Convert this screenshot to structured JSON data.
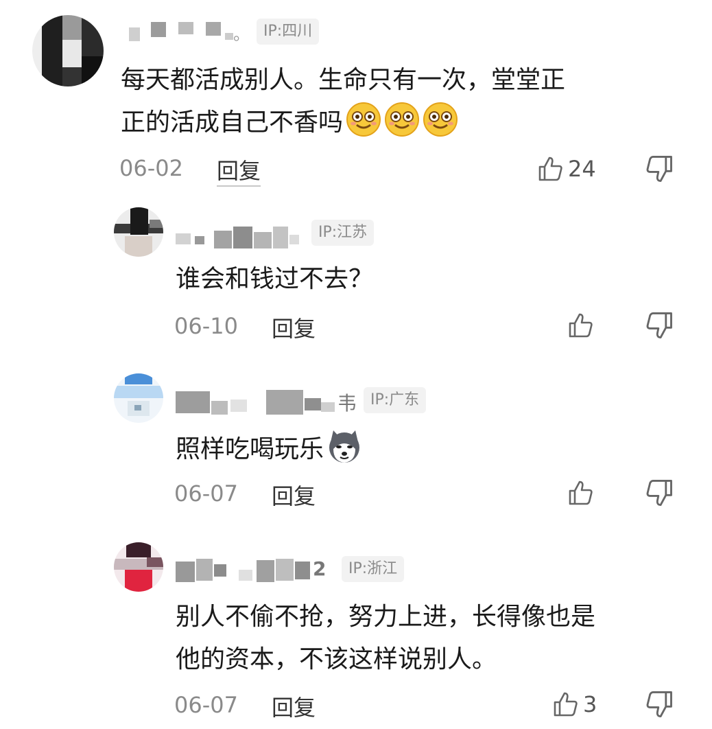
{
  "comments": [
    {
      "ip": "IP:四川",
      "name_suffix": "。",
      "lines": [
        "每天都活成别人。生命只有一次，堂堂正",
        "正的活成自己不香吗"
      ],
      "emojis": [
        "smile-emoji",
        "smile-emoji",
        "smile-emoji"
      ],
      "date": "06-02",
      "reply": "回复",
      "likes": "24"
    },
    {
      "ip": "IP:江苏",
      "lines": [
        "谁会和钱过不去？"
      ],
      "date": "06-10",
      "reply": "回复",
      "likes": ""
    },
    {
      "ip": "IP:广东",
      "name_suffix": "韦",
      "lines": [
        "照样吃喝玩乐"
      ],
      "emojis": [
        "husky-dog-emoji"
      ],
      "date": "06-07",
      "reply": "回复",
      "likes": ""
    },
    {
      "ip": "IP:浙江",
      "name_suffix": "2",
      "lines": [
        "别人不偷不抢，努力上进，长得像也是",
        "他的资本，不该这样说别人。"
      ],
      "date": "06-07",
      "reply": "回复",
      "likes": "3"
    }
  ],
  "colors": {
    "text": "#1a1a1a",
    "meta": "#8a8a8a",
    "badge_bg": "#f2f2f2",
    "icon": "#666666"
  }
}
